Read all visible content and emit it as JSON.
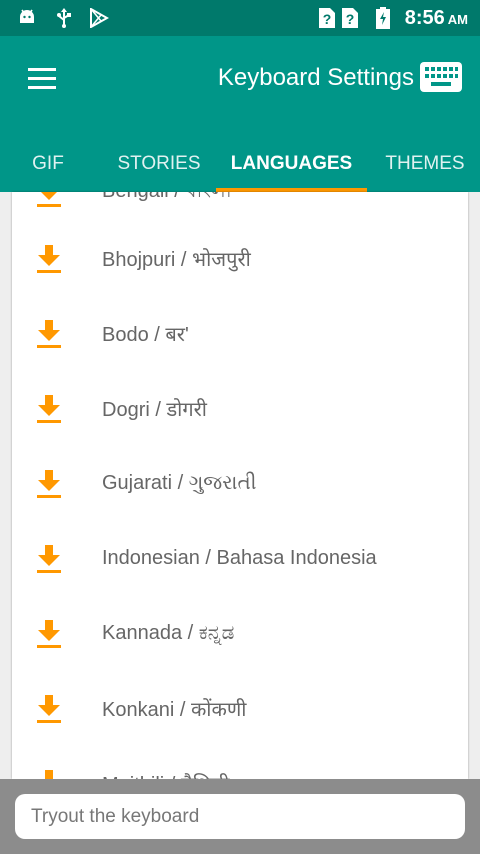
{
  "status_bar": {
    "time": "8:56",
    "ampm": "AM",
    "icons": [
      "android-icon",
      "usb-icon",
      "play-store-icon",
      "unknown-sim-icon",
      "unknown-sim-icon",
      "battery-charging-icon"
    ]
  },
  "app_bar": {
    "title": "Keyboard Settings",
    "menu_icon": "hamburger-menu-icon",
    "keyboard_icon": "keyboard-icon"
  },
  "tabs": [
    {
      "label": "GIF",
      "active": false
    },
    {
      "label": "STORIES",
      "active": false
    },
    {
      "label": "LANGUAGES",
      "active": true
    },
    {
      "label": "THEMES",
      "active": false
    }
  ],
  "languages": [
    {
      "label": "Bengali / বাংলা"
    },
    {
      "label": "Bhojpuri / भोजपुरी"
    },
    {
      "label": "Bodo / बर'"
    },
    {
      "label": "Dogri / डोगरी"
    },
    {
      "label": "Gujarati / ગુજરાતી"
    },
    {
      "label": "Indonesian / Bahasa Indonesia"
    },
    {
      "label": "Kannada / ಕನ್ನಡ"
    },
    {
      "label": "Konkani / कोंकणी"
    },
    {
      "label": "Maithili / मैथिली"
    }
  ],
  "download_icon": "download-icon",
  "tryout": {
    "placeholder": "Tryout the keyboard"
  },
  "colors": {
    "status_bar": "#00796b",
    "app_bar": "#009688",
    "accent": "#ff9800"
  }
}
